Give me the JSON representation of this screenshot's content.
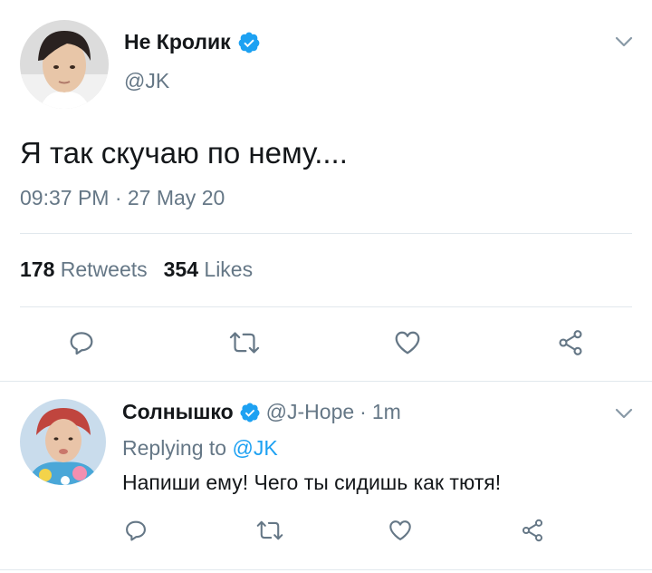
{
  "tweet": {
    "display_name": "Не Кролик",
    "handle": "@JK",
    "text": "Я так скучаю по нему....",
    "timestamp": "09:37 PM · 27 May 20",
    "retweets_count": "178",
    "retweets_label": "Retweets",
    "likes_count": "354",
    "likes_label": "Likes"
  },
  "reply": {
    "display_name": "Солнышко",
    "handle": "@J-Hope",
    "separator": "·",
    "time": "1m",
    "replying_prefix": "Replying to",
    "replying_to": "@JK",
    "text": "Напиши ему! Чего ты сидишь как тютя!"
  },
  "icons": {
    "verified": "verified-badge-icon",
    "reply": "reply-icon",
    "retweet": "retweet-icon",
    "like": "heart-icon",
    "share": "share-icon",
    "menu": "chevron-down-icon"
  },
  "colors": {
    "accent": "#1da1f2",
    "text": "#14171a",
    "secondary": "#657786",
    "divider": "#e1e8ed"
  }
}
